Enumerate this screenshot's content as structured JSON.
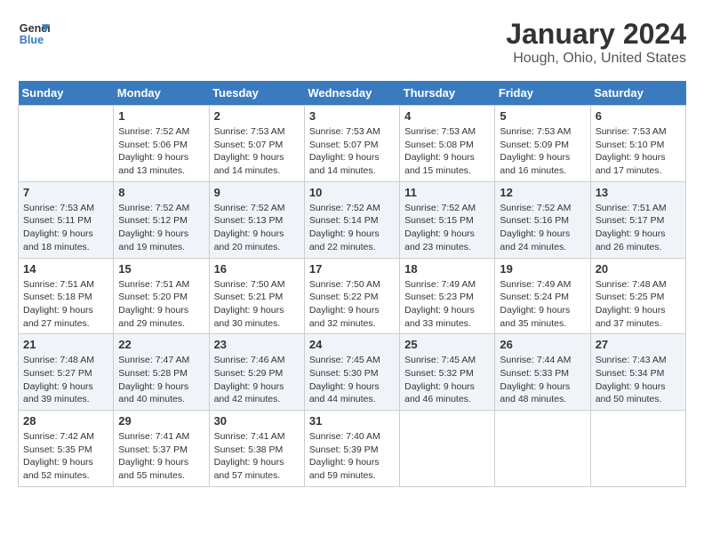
{
  "logo": {
    "line1": "General",
    "line2": "Blue"
  },
  "title": "January 2024",
  "subtitle": "Hough, Ohio, United States",
  "days_of_week": [
    "Sunday",
    "Monday",
    "Tuesday",
    "Wednesday",
    "Thursday",
    "Friday",
    "Saturday"
  ],
  "weeks": [
    [
      {
        "day": "",
        "sunrise": "",
        "sunset": "",
        "daylight": ""
      },
      {
        "day": "1",
        "sunrise": "Sunrise: 7:52 AM",
        "sunset": "Sunset: 5:06 PM",
        "daylight": "Daylight: 9 hours and 13 minutes."
      },
      {
        "day": "2",
        "sunrise": "Sunrise: 7:53 AM",
        "sunset": "Sunset: 5:07 PM",
        "daylight": "Daylight: 9 hours and 14 minutes."
      },
      {
        "day": "3",
        "sunrise": "Sunrise: 7:53 AM",
        "sunset": "Sunset: 5:07 PM",
        "daylight": "Daylight: 9 hours and 14 minutes."
      },
      {
        "day": "4",
        "sunrise": "Sunrise: 7:53 AM",
        "sunset": "Sunset: 5:08 PM",
        "daylight": "Daylight: 9 hours and 15 minutes."
      },
      {
        "day": "5",
        "sunrise": "Sunrise: 7:53 AM",
        "sunset": "Sunset: 5:09 PM",
        "daylight": "Daylight: 9 hours and 16 minutes."
      },
      {
        "day": "6",
        "sunrise": "Sunrise: 7:53 AM",
        "sunset": "Sunset: 5:10 PM",
        "daylight": "Daylight: 9 hours and 17 minutes."
      }
    ],
    [
      {
        "day": "7",
        "sunrise": "Sunrise: 7:53 AM",
        "sunset": "Sunset: 5:11 PM",
        "daylight": "Daylight: 9 hours and 18 minutes."
      },
      {
        "day": "8",
        "sunrise": "Sunrise: 7:52 AM",
        "sunset": "Sunset: 5:12 PM",
        "daylight": "Daylight: 9 hours and 19 minutes."
      },
      {
        "day": "9",
        "sunrise": "Sunrise: 7:52 AM",
        "sunset": "Sunset: 5:13 PM",
        "daylight": "Daylight: 9 hours and 20 minutes."
      },
      {
        "day": "10",
        "sunrise": "Sunrise: 7:52 AM",
        "sunset": "Sunset: 5:14 PM",
        "daylight": "Daylight: 9 hours and 22 minutes."
      },
      {
        "day": "11",
        "sunrise": "Sunrise: 7:52 AM",
        "sunset": "Sunset: 5:15 PM",
        "daylight": "Daylight: 9 hours and 23 minutes."
      },
      {
        "day": "12",
        "sunrise": "Sunrise: 7:52 AM",
        "sunset": "Sunset: 5:16 PM",
        "daylight": "Daylight: 9 hours and 24 minutes."
      },
      {
        "day": "13",
        "sunrise": "Sunrise: 7:51 AM",
        "sunset": "Sunset: 5:17 PM",
        "daylight": "Daylight: 9 hours and 26 minutes."
      }
    ],
    [
      {
        "day": "14",
        "sunrise": "Sunrise: 7:51 AM",
        "sunset": "Sunset: 5:18 PM",
        "daylight": "Daylight: 9 hours and 27 minutes."
      },
      {
        "day": "15",
        "sunrise": "Sunrise: 7:51 AM",
        "sunset": "Sunset: 5:20 PM",
        "daylight": "Daylight: 9 hours and 29 minutes."
      },
      {
        "day": "16",
        "sunrise": "Sunrise: 7:50 AM",
        "sunset": "Sunset: 5:21 PM",
        "daylight": "Daylight: 9 hours and 30 minutes."
      },
      {
        "day": "17",
        "sunrise": "Sunrise: 7:50 AM",
        "sunset": "Sunset: 5:22 PM",
        "daylight": "Daylight: 9 hours and 32 minutes."
      },
      {
        "day": "18",
        "sunrise": "Sunrise: 7:49 AM",
        "sunset": "Sunset: 5:23 PM",
        "daylight": "Daylight: 9 hours and 33 minutes."
      },
      {
        "day": "19",
        "sunrise": "Sunrise: 7:49 AM",
        "sunset": "Sunset: 5:24 PM",
        "daylight": "Daylight: 9 hours and 35 minutes."
      },
      {
        "day": "20",
        "sunrise": "Sunrise: 7:48 AM",
        "sunset": "Sunset: 5:25 PM",
        "daylight": "Daylight: 9 hours and 37 minutes."
      }
    ],
    [
      {
        "day": "21",
        "sunrise": "Sunrise: 7:48 AM",
        "sunset": "Sunset: 5:27 PM",
        "daylight": "Daylight: 9 hours and 39 minutes."
      },
      {
        "day": "22",
        "sunrise": "Sunrise: 7:47 AM",
        "sunset": "Sunset: 5:28 PM",
        "daylight": "Daylight: 9 hours and 40 minutes."
      },
      {
        "day": "23",
        "sunrise": "Sunrise: 7:46 AM",
        "sunset": "Sunset: 5:29 PM",
        "daylight": "Daylight: 9 hours and 42 minutes."
      },
      {
        "day": "24",
        "sunrise": "Sunrise: 7:45 AM",
        "sunset": "Sunset: 5:30 PM",
        "daylight": "Daylight: 9 hours and 44 minutes."
      },
      {
        "day": "25",
        "sunrise": "Sunrise: 7:45 AM",
        "sunset": "Sunset: 5:32 PM",
        "daylight": "Daylight: 9 hours and 46 minutes."
      },
      {
        "day": "26",
        "sunrise": "Sunrise: 7:44 AM",
        "sunset": "Sunset: 5:33 PM",
        "daylight": "Daylight: 9 hours and 48 minutes."
      },
      {
        "day": "27",
        "sunrise": "Sunrise: 7:43 AM",
        "sunset": "Sunset: 5:34 PM",
        "daylight": "Daylight: 9 hours and 50 minutes."
      }
    ],
    [
      {
        "day": "28",
        "sunrise": "Sunrise: 7:42 AM",
        "sunset": "Sunset: 5:35 PM",
        "daylight": "Daylight: 9 hours and 52 minutes."
      },
      {
        "day": "29",
        "sunrise": "Sunrise: 7:41 AM",
        "sunset": "Sunset: 5:37 PM",
        "daylight": "Daylight: 9 hours and 55 minutes."
      },
      {
        "day": "30",
        "sunrise": "Sunrise: 7:41 AM",
        "sunset": "Sunset: 5:38 PM",
        "daylight": "Daylight: 9 hours and 57 minutes."
      },
      {
        "day": "31",
        "sunrise": "Sunrise: 7:40 AM",
        "sunset": "Sunset: 5:39 PM",
        "daylight": "Daylight: 9 hours and 59 minutes."
      },
      {
        "day": "",
        "sunrise": "",
        "sunset": "",
        "daylight": ""
      },
      {
        "day": "",
        "sunrise": "",
        "sunset": "",
        "daylight": ""
      },
      {
        "day": "",
        "sunrise": "",
        "sunset": "",
        "daylight": ""
      }
    ]
  ]
}
